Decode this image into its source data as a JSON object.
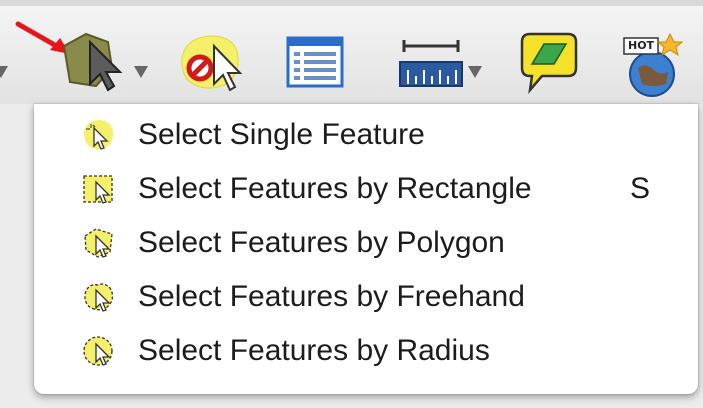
{
  "toolbar": {
    "buttons": [
      {
        "name": "select-features-tool-icon",
        "has_dropdown": true
      },
      {
        "name": "deselect-features-icon",
        "has_dropdown": false
      },
      {
        "name": "attribute-table-icon",
        "has_dropdown": false
      },
      {
        "name": "measure-ruler-icon",
        "has_dropdown": true
      },
      {
        "name": "map-tips-icon",
        "has_dropdown": false
      },
      {
        "name": "new-bookmark-globe-icon",
        "has_dropdown": false,
        "label": "HOT"
      }
    ],
    "pointer_arrow_color": "#e8141b"
  },
  "menu": {
    "items": [
      {
        "label": "Select Single Feature",
        "shortcut": "",
        "icon": "select-single-feature-icon"
      },
      {
        "label": "Select Features by Rectangle",
        "shortcut": "S",
        "icon": "select-rectangle-icon"
      },
      {
        "label": "Select Features by Polygon",
        "shortcut": "",
        "icon": "select-polygon-icon"
      },
      {
        "label": "Select Features by Freehand",
        "shortcut": "",
        "icon": "select-freehand-icon"
      },
      {
        "label": "Select Features by Radius",
        "shortcut": "",
        "icon": "select-radius-icon"
      }
    ]
  },
  "colors": {
    "highlight_yellow": "#f5f06a",
    "menu_background": "#ffffff"
  }
}
